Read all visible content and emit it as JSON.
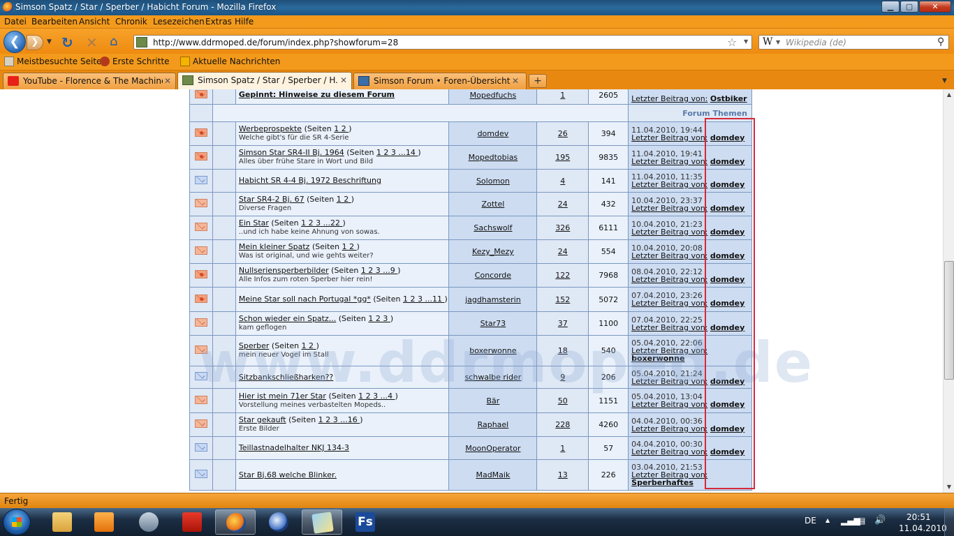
{
  "window": {
    "title": "Simson Spatz / Star / Sperber / Habicht Forum - Mozilla Firefox",
    "min": "▁",
    "max": "▢",
    "close": "✕"
  },
  "menu": [
    "Datei",
    "Bearbeiten",
    "Ansicht",
    "Chronik",
    "Lesezeichen",
    "Extras",
    "Hilfe"
  ],
  "nav": {
    "url": "http://www.ddrmoped.de/forum/index.php?showforum=28",
    "search_engine_glyph": "W",
    "search_placeholder": "Wikipedia (de)"
  },
  "bookmarks": [
    "Meistbesuchte Seiten",
    "Erste Schritte",
    "Aktuelle Nachrichten"
  ],
  "tabs": [
    {
      "label": "YouTube - Florence & The Machine...",
      "active": false
    },
    {
      "label": "Simson Spatz / Star / Sperber / H...",
      "active": true
    },
    {
      "label": "Simson Forum • Foren-Übersicht",
      "active": false
    }
  ],
  "forum": {
    "pinned": {
      "title": "Gepinnt: Hinweise zu diesem Forum",
      "author": "Mopedfuchs",
      "replies": "1",
      "views": "2605",
      "last_label": "Letzter Beitrag von:",
      "last_user": "Ostbiker"
    },
    "section_label": "Forum Themen",
    "topics": [
      {
        "title": "Werbeprospekte",
        "pages": "(Seiten ",
        "page_links": "1 2 ",
        "pages_end": ")",
        "desc": "Welche gibt's für die SR 4-Serie",
        "author": "domdev",
        "replies": "26",
        "views": "394",
        "date": "11.04.2010, 19:44",
        "last_label": "Letzter Beitrag von:",
        "last_user": "domdey",
        "icon": "hot"
      },
      {
        "title": "Simson Star SR4-II Bj. 1964",
        "pages": "(Seiten ",
        "page_links": "1 2 3 ...14 ",
        "pages_end": ")",
        "desc": "Alles über frühe Stare in Wort und Bild",
        "author": "Mopedtobias",
        "replies": "195",
        "views": "9835",
        "date": "11.04.2010, 19:41",
        "last_label": "Letzter Beitrag von:",
        "last_user": "domdey",
        "icon": "hot"
      },
      {
        "title": "Habicht SR 4-4 Bj. 1972 Beschriftung",
        "pages": "",
        "page_links": "",
        "pages_end": "",
        "desc": "",
        "author": "Solomon",
        "replies": "4",
        "views": "141",
        "date": "11.04.2010, 11:35",
        "last_label": "Letzter Beitrag von:",
        "last_user": "domdey",
        "icon": "blue"
      },
      {
        "title": "Star SR4-2 Bj. 67",
        "pages": "(Seiten ",
        "page_links": "1 2 ",
        "pages_end": ")",
        "desc": "Diverse Fragen",
        "author": "Zottel",
        "replies": "24",
        "views": "432",
        "date": "10.04.2010, 23:37",
        "last_label": "Letzter Beitrag von:",
        "last_user": "domdey",
        "icon": "red"
      },
      {
        "title": "Ein Star",
        "pages": "(Seiten ",
        "page_links": "1 2 3 ...22 ",
        "pages_end": ")",
        "desc": "..und ich habe keine Ahnung von sowas.",
        "author": "Sachswolf",
        "replies": "326",
        "views": "6111",
        "date": "10.04.2010, 21:23",
        "last_label": "Letzter Beitrag von:",
        "last_user": "domdey",
        "icon": "red"
      },
      {
        "title": "Mein kleiner Spatz",
        "pages": "(Seiten ",
        "page_links": "1 2 ",
        "pages_end": ")",
        "desc": "Was ist original, und wie gehts weiter?",
        "author": "Kezy_Mezy",
        "replies": "24",
        "views": "554",
        "date": "10.04.2010, 20:08",
        "last_label": "Letzter Beitrag von:",
        "last_user": "domdey",
        "icon": "red"
      },
      {
        "title": "Nullseriensperberbilder",
        "pages": "(Seiten ",
        "page_links": "1 2 3 ...9 ",
        "pages_end": ")",
        "desc": "Alle Infos zum roten Sperber hier rein!",
        "author": "Concorde",
        "replies": "122",
        "views": "7968",
        "date": "08.04.2010, 22:12",
        "last_label": "Letzter Beitrag von:",
        "last_user": "domdey",
        "icon": "hot"
      },
      {
        "title": "Meine Star soll nach Portugal *gg*",
        "pages": "(Seiten ",
        "page_links": "1 2 3 ...11 ",
        "pages_end": ")",
        "desc": "",
        "author": "jagdhamsterin",
        "replies": "152",
        "views": "5072",
        "date": "07.04.2010, 23:26",
        "last_label": "Letzter Beitrag von:",
        "last_user": "domdey",
        "icon": "hot"
      },
      {
        "title": "Schon wieder ein Spatz...",
        "pages": "(Seiten ",
        "page_links": "1 2 3 ",
        "pages_end": ")",
        "desc": "kam geflogen",
        "author": "Star73",
        "replies": "37",
        "views": "1100",
        "date": "07.04.2010, 22:25",
        "last_label": "Letzter Beitrag von:",
        "last_user": "domdey",
        "icon": "red"
      },
      {
        "title": "Sperber",
        "pages": "(Seiten ",
        "page_links": "1 2 ",
        "pages_end": ")",
        "desc": "mein neuer Vogel im Stall",
        "author": "boxerwonne",
        "replies": "18",
        "views": "540",
        "date": "05.04.2010, 22:06",
        "last_label": "Letzter Beitrag von:",
        "last_user": "boxerwonne",
        "icon": "red"
      },
      {
        "title": "Sitzbankschließharken??",
        "pages": "",
        "page_links": "",
        "pages_end": "",
        "desc": "",
        "author": "schwalbe rider",
        "replies": "9",
        "views": "206",
        "date": "05.04.2010, 21:24",
        "last_label": "Letzter Beitrag von:",
        "last_user": "domdey",
        "icon": "blue"
      },
      {
        "title": "Hier ist mein 71er Star",
        "pages": "(Seiten ",
        "page_links": "1 2 3 ...4 ",
        "pages_end": ")",
        "desc": "Vorstellung meines verbastelten Mopeds..",
        "author": "Bär",
        "replies": "50",
        "views": "1151",
        "date": "05.04.2010, 13:04",
        "last_label": "Letzter Beitrag von:",
        "last_user": "domdey",
        "icon": "red"
      },
      {
        "title": "Star gekauft",
        "pages": "(Seiten ",
        "page_links": "1 2 3 ...16 ",
        "pages_end": ")",
        "desc": "Erste Bilder",
        "author": "Raphael",
        "replies": "228",
        "views": "4260",
        "date": "04.04.2010, 00:36",
        "last_label": "Letzter Beitrag von:",
        "last_user": "domdey",
        "icon": "red"
      },
      {
        "title": "Teillastnadelhalter NKJ 134-3",
        "pages": "",
        "page_links": "",
        "pages_end": "",
        "desc": "",
        "author": "MoonOperator",
        "replies": "1",
        "views": "57",
        "date": "04.04.2010, 00:30",
        "last_label": "Letzter Beitrag von:",
        "last_user": "domdey",
        "icon": "blue"
      },
      {
        "title": "Star Bj.68 welche Blinker.",
        "pages": "",
        "page_links": "",
        "pages_end": "",
        "desc": "",
        "author": "MadMaik",
        "replies": "13",
        "views": "226",
        "date": "03.04.2010, 21:53",
        "last_label": "Letzter Beitrag von:",
        "last_user": "Sperberhaftes",
        "icon": "blue"
      }
    ]
  },
  "watermark": "www.ddrmoped.de",
  "status": "Fertig",
  "tray": {
    "lang": "DE",
    "time": "20:51",
    "date": "11.04.2010"
  },
  "taskbar_apps": [
    "explorer-folder",
    "media-player",
    "network-tool",
    "pdf-reader",
    "firefox",
    "thunderbird",
    "image-viewer",
    "fs-app"
  ],
  "taskbar_fs_label": "Fs",
  "colors": {
    "accent_orange": "#f39a1c",
    "table_border": "#7a98c0",
    "highlight_box": "#d6283a"
  }
}
